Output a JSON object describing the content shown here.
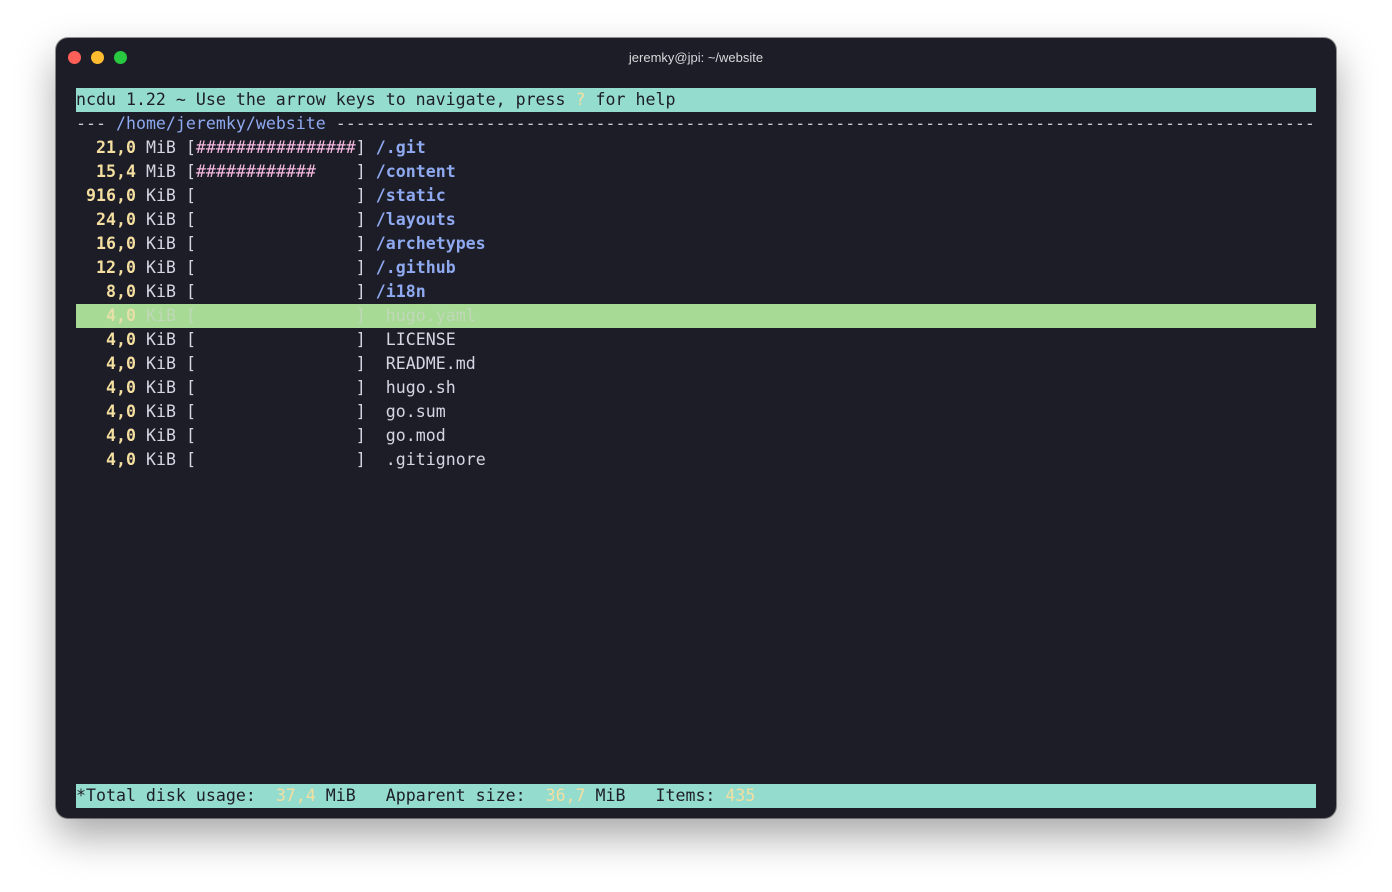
{
  "window": {
    "title": "jeremky@jpi: ~/website"
  },
  "header": {
    "prefix": "ncdu 1.22 ~ Use the arrow keys to navigate, press ",
    "key": "?",
    "suffix": " for help"
  },
  "path": {
    "dashes_before": "--- ",
    "dir": "/home/jeremky/website",
    "dashes_after": " --------------------------------------------------------------------------------------------------------"
  },
  "entries": [
    {
      "size": "21,0",
      "unit": "MiB",
      "bar": "################",
      "name": "/.git",
      "type": "dir"
    },
    {
      "size": "15,4",
      "unit": "MiB",
      "bar": "############    ",
      "name": "/content",
      "type": "dir"
    },
    {
      "size": "916,0",
      "unit": "KiB",
      "bar": "                ",
      "name": "/static",
      "type": "dir"
    },
    {
      "size": "24,0",
      "unit": "KiB",
      "bar": "                ",
      "name": "/layouts",
      "type": "dir"
    },
    {
      "size": "16,0",
      "unit": "KiB",
      "bar": "                ",
      "name": "/archetypes",
      "type": "dir"
    },
    {
      "size": "12,0",
      "unit": "KiB",
      "bar": "                ",
      "name": "/.github",
      "type": "dir"
    },
    {
      "size": "8,0",
      "unit": "KiB",
      "bar": "                ",
      "name": "/i18n",
      "type": "dir"
    },
    {
      "size": "4,0",
      "unit": "KiB",
      "bar": "                ",
      "name": "hugo.yaml",
      "type": "file",
      "selected": true
    },
    {
      "size": "4,0",
      "unit": "KiB",
      "bar": "                ",
      "name": "LICENSE",
      "type": "file"
    },
    {
      "size": "4,0",
      "unit": "KiB",
      "bar": "                ",
      "name": "README.md",
      "type": "file"
    },
    {
      "size": "4,0",
      "unit": "KiB",
      "bar": "                ",
      "name": "hugo.sh",
      "type": "file"
    },
    {
      "size": "4,0",
      "unit": "KiB",
      "bar": "                ",
      "name": "go.sum",
      "type": "file"
    },
    {
      "size": "4,0",
      "unit": "KiB",
      "bar": "                ",
      "name": "go.mod",
      "type": "file"
    },
    {
      "size": "4,0",
      "unit": "KiB",
      "bar": "                ",
      "name": ".gitignore",
      "type": "file"
    }
  ],
  "footer": {
    "total_label": "*Total disk usage:  ",
    "total_value": "37,4",
    "total_unit": " MiB   ",
    "apparent_label": "Apparent size:  ",
    "apparent_value": "36,7",
    "apparent_unit": " MiB   ",
    "items_label": "Items: ",
    "items_value": "435"
  },
  "colors": {
    "background": "#1c1d26",
    "header_bg": "#94dccd",
    "selected_bg": "#a6da95",
    "size_color": "#f4dea0",
    "dir_color": "#8fa9f0",
    "bar_color": "#f4b8e0"
  }
}
